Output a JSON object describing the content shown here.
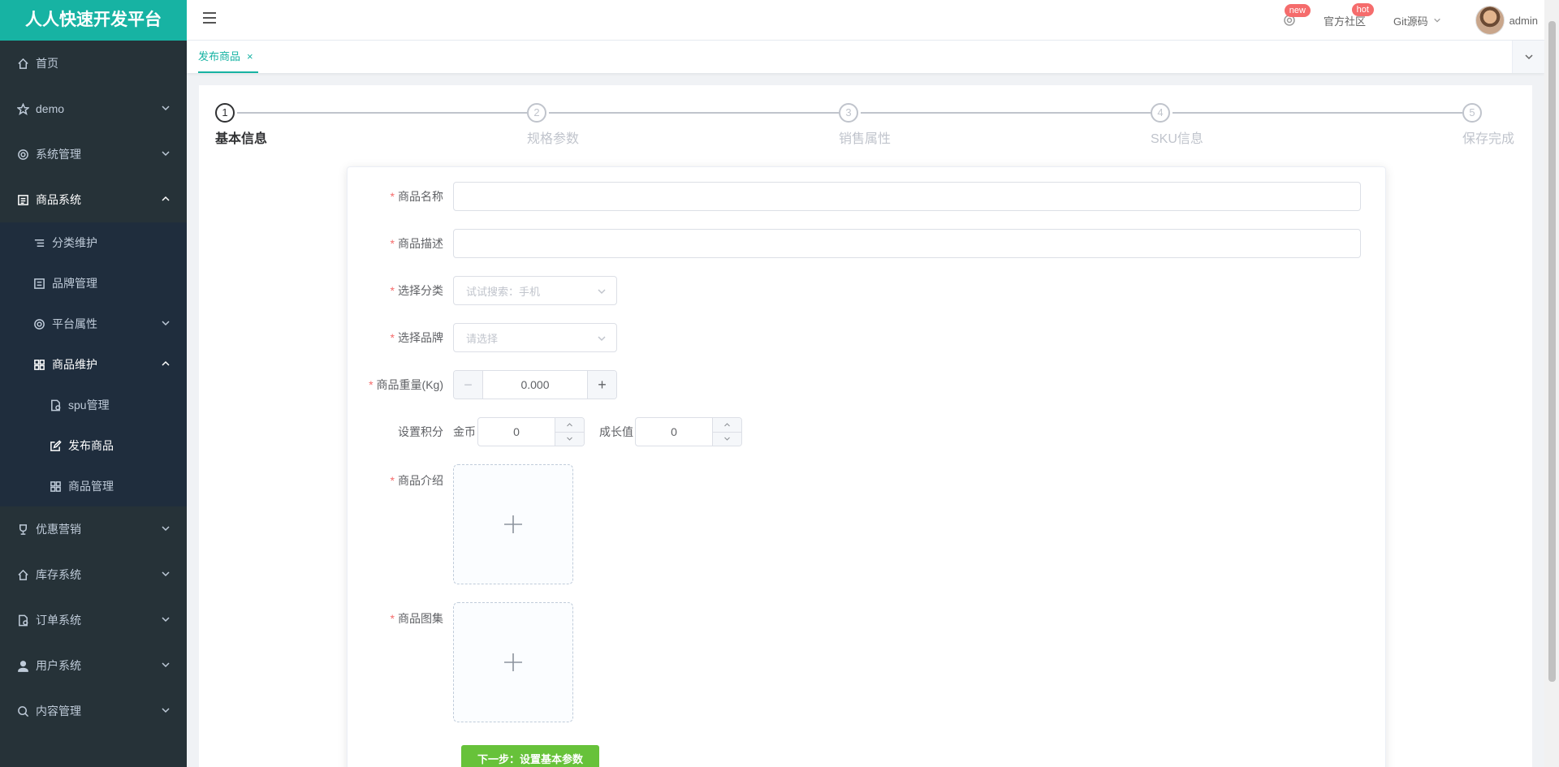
{
  "app": {
    "title": "人人快速开发平台"
  },
  "sidebar": {
    "items": [
      {
        "label": "首页"
      },
      {
        "label": "demo"
      },
      {
        "label": "系统管理"
      },
      {
        "label": "商品系统"
      },
      {
        "label": "分类维护"
      },
      {
        "label": "品牌管理"
      },
      {
        "label": "平台属性"
      },
      {
        "label": "商品维护"
      },
      {
        "label": "spu管理"
      },
      {
        "label": "发布商品"
      },
      {
        "label": "商品管理"
      },
      {
        "label": "优惠营销"
      },
      {
        "label": "库存系统"
      },
      {
        "label": "订单系统"
      },
      {
        "label": "用户系统"
      },
      {
        "label": "内容管理"
      }
    ]
  },
  "topbar": {
    "new_badge": "new",
    "community": "官方社区",
    "hot_badge": "hot",
    "git": "Git源码",
    "user": "admin"
  },
  "tabs": {
    "active": "发布商品",
    "close": "×"
  },
  "steps": [
    {
      "num": "1",
      "title": "基本信息"
    },
    {
      "num": "2",
      "title": "规格参数"
    },
    {
      "num": "3",
      "title": "销售属性"
    },
    {
      "num": "4",
      "title": "SKU信息"
    },
    {
      "num": "5",
      "title": "保存完成"
    }
  ],
  "form": {
    "name_label": "商品名称",
    "desc_label": "商品描述",
    "category_label": "选择分类",
    "category_placeholder": "试试搜索：手机",
    "brand_label": "选择品牌",
    "brand_placeholder": "请选择",
    "weight_label": "商品重量(Kg)",
    "weight_value": "0.000",
    "points_label": "设置积分",
    "coins_label": "金币",
    "coins_value": "0",
    "growth_label": "成长值",
    "growth_value": "0",
    "intro_label": "商品介绍",
    "gallery_label": "商品图集",
    "next_button": "下一步：设置基本参数"
  },
  "colors": {
    "brand": "#17b3a3",
    "sidebar": "#263238",
    "submenu": "#1f2d3d",
    "success": "#67c23a"
  }
}
